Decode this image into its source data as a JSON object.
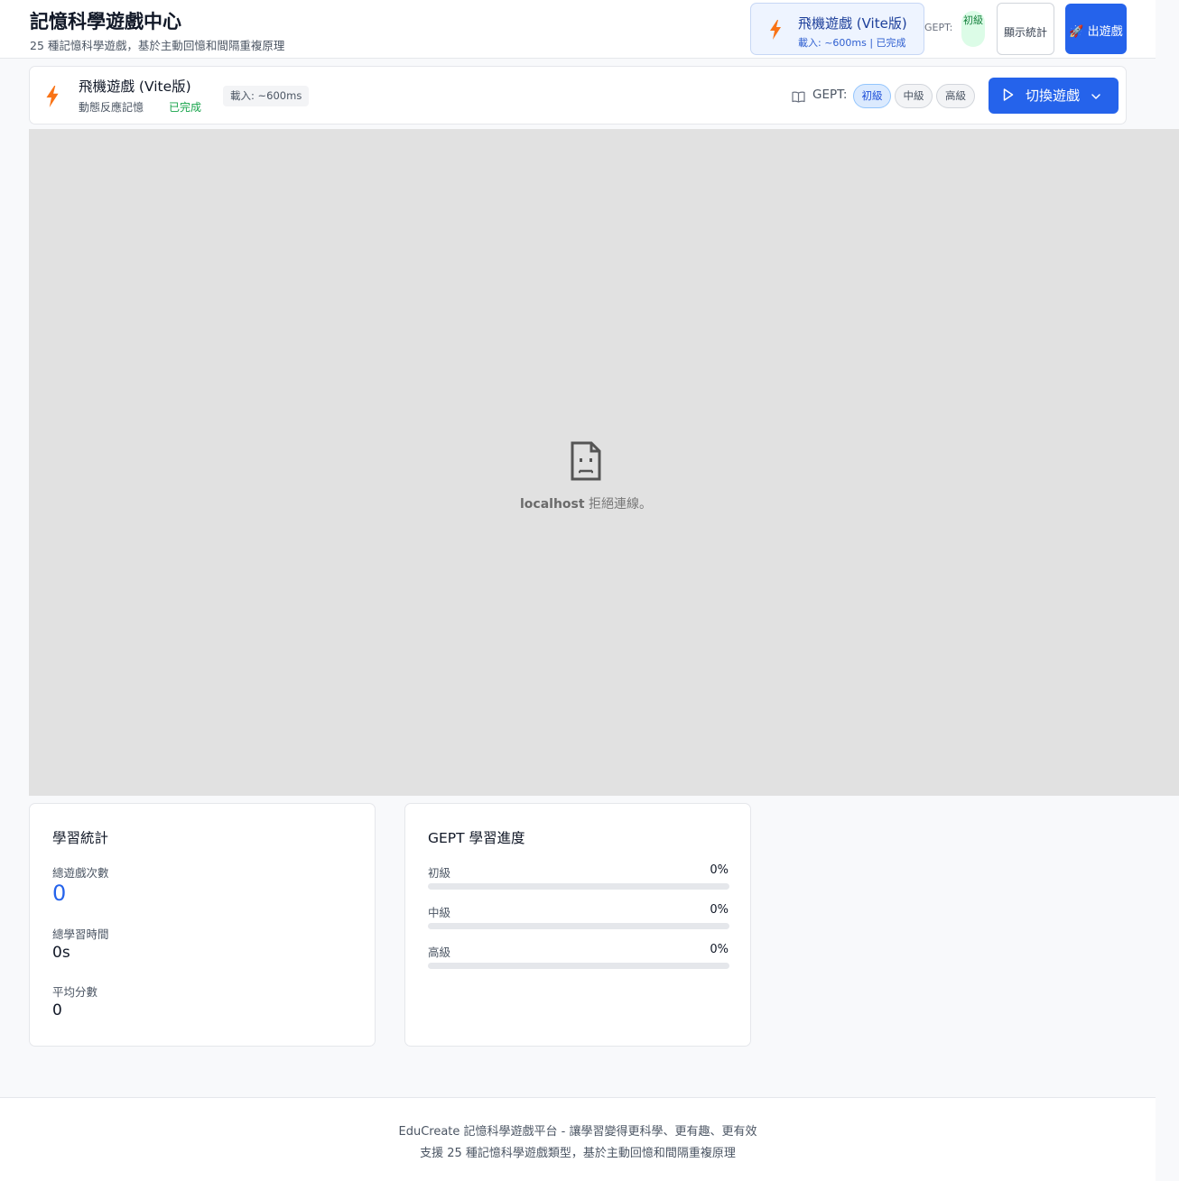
{
  "header": {
    "title": "記憶科學遊戲中心",
    "subtitle": "25 種記憶科學遊戲，基於主動回憶和間隔重複原理",
    "current_game": {
      "name": "飛機遊戲 (Vite版)",
      "meta": "載入: ~600ms | 已完成"
    },
    "gept_label": "GEPT:",
    "gept_level": "初級",
    "stats_button": "顯示統計",
    "launch_button": "🚀 出遊戲"
  },
  "game_bar": {
    "name": "飛機遊戲 (Vite版)",
    "category": "動態反應記憶",
    "status": "已完成",
    "load_time": "載入: ~600ms",
    "gept_label": "GEPT:",
    "levels": [
      "初級",
      "中級",
      "高級"
    ],
    "active_level": "初級",
    "switch_button": "切換遊戲"
  },
  "frame": {
    "error_host": "localhost",
    "error_message": " 拒絕連線。"
  },
  "stats": {
    "title": "學習統計",
    "total_games_label": "總遊戲次數",
    "total_games_value": "0",
    "total_time_label": "總學習時間",
    "total_time_value": "0s",
    "avg_score_label": "平均分數",
    "avg_score_value": "0"
  },
  "progress": {
    "title": "GEPT 學習進度",
    "levels": [
      {
        "label": "初級",
        "percent_text": "0%",
        "percent": 0
      },
      {
        "label": "中級",
        "percent_text": "0%",
        "percent": 0
      },
      {
        "label": "高級",
        "percent_text": "0%",
        "percent": 0
      }
    ]
  },
  "footer": {
    "line1": "EduCreate 記憶科學遊戲平台 - 讓學習變得更科學、更有趣、更有效",
    "line2": "支援 25 種記憶科學遊戲類型，基於主動回憶和間隔重複原理"
  },
  "colors": {
    "accent": "#2563eb",
    "bolt": "#f97316",
    "success": "#16a34a",
    "frame_bg": "#e1e1e1"
  }
}
